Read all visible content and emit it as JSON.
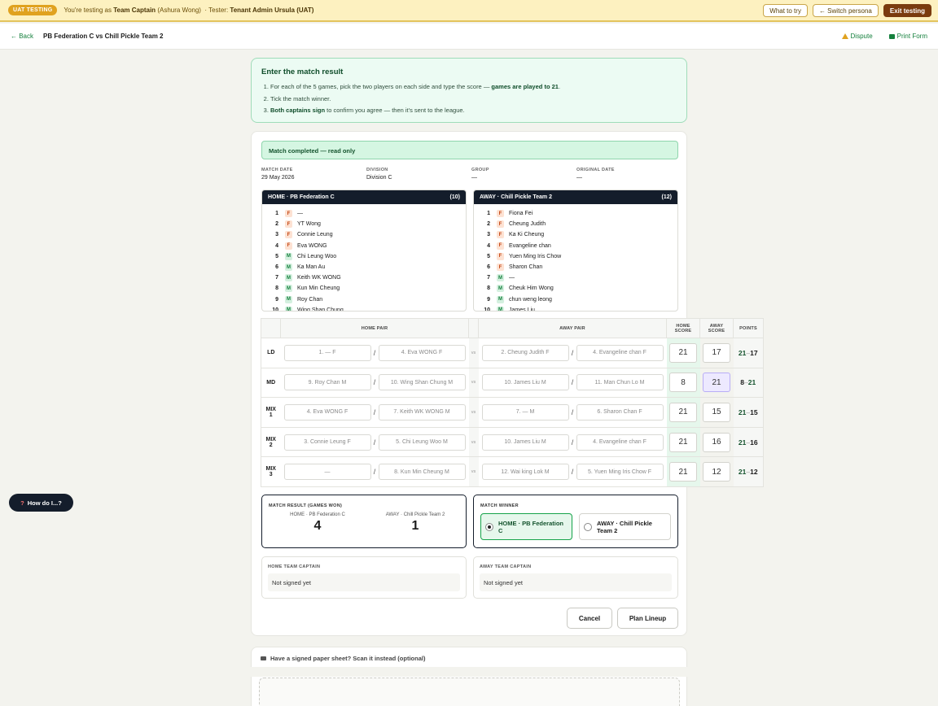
{
  "banner": {
    "pill": "UAT TESTING",
    "prefix": "You're testing as",
    "persona": "Team Captain",
    "persona_name": "(Ashura Wong)",
    "tester_label": "· Tester:",
    "tester": "Tenant Admin Ursula (UAT)",
    "what_to_try": "What to try",
    "switch_persona": "← Switch persona",
    "exit_testing": "Exit testing"
  },
  "header": {
    "back": "← Back",
    "title": "PB Federation C vs Chill Pickle Team 2",
    "dispute": "Dispute",
    "print": "Print Form"
  },
  "instructions": {
    "title": "Enter the match result",
    "step1_a": "For each of the 5 games, pick the two players on each side and type the score — ",
    "step1_b": "games are played to 21",
    "step1_c": ".",
    "step2": "Tick the match winner.",
    "step3_a": "Both captains sign",
    "step3_b": " to confirm you agree — then it's sent to the league."
  },
  "status": "Match completed — read only",
  "meta": {
    "match_date_label": "MATCH DATE",
    "match_date": "29 May 2026",
    "division_label": "DIVISION",
    "division": "Division C",
    "group_label": "GROUP",
    "group": "—",
    "orig_date_label": "ORIGINAL DATE",
    "orig_date": "—"
  },
  "home_roster": {
    "title": "HOME · PB Federation C",
    "count": "(10)",
    "players": [
      {
        "n": "1",
        "g": "F",
        "name": "—"
      },
      {
        "n": "2",
        "g": "F",
        "name": "YT Wong"
      },
      {
        "n": "3",
        "g": "F",
        "name": "Connie Leung"
      },
      {
        "n": "4",
        "g": "F",
        "name": "Eva WONG"
      },
      {
        "n": "5",
        "g": "M",
        "name": "Chi Leung Woo"
      },
      {
        "n": "6",
        "g": "M",
        "name": "Ka Man Au"
      },
      {
        "n": "7",
        "g": "M",
        "name": "Keith WK WONG"
      },
      {
        "n": "8",
        "g": "M",
        "name": "Kun Min Cheung"
      },
      {
        "n": "9",
        "g": "M",
        "name": "Roy Chan"
      },
      {
        "n": "10",
        "g": "M",
        "name": "Wing Shan Chung"
      }
    ]
  },
  "away_roster": {
    "title": "AWAY · Chill Pickle Team 2",
    "count": "(12)",
    "players": [
      {
        "n": "1",
        "g": "F",
        "name": "Fiona Fei"
      },
      {
        "n": "2",
        "g": "F",
        "name": "Cheung Judith"
      },
      {
        "n": "3",
        "g": "F",
        "name": "Ka Ki Cheung"
      },
      {
        "n": "4",
        "g": "F",
        "name": "Evangeline chan"
      },
      {
        "n": "5",
        "g": "F",
        "name": "Yuen Ming Iris Chow"
      },
      {
        "n": "6",
        "g": "F",
        "name": "Sharon Chan"
      },
      {
        "n": "7",
        "g": "M",
        "name": "—"
      },
      {
        "n": "8",
        "g": "M",
        "name": "Cheuk Him Wong"
      },
      {
        "n": "9",
        "g": "M",
        "name": "chun weng leong"
      },
      {
        "n": "10",
        "g": "M",
        "name": "James Liu"
      }
    ]
  },
  "games_header": {
    "home_pair": "HOME PAIR",
    "away_pair": "AWAY PAIR",
    "home_score_1": "HOME",
    "home_score_2": "SCORE",
    "away_score_1": "AWAY",
    "away_score_2": "SCORE",
    "points": "POINTS",
    "vs": "vs"
  },
  "games": [
    {
      "l1": "LD",
      "l2": "",
      "h1": "1. — F",
      "h2": "4. Eva WONG F",
      "a1": "2. Cheung Judith F",
      "a2": "4. Evangeline chan F",
      "hs": "21",
      "as": "17",
      "p1": "21",
      "p2": "17",
      "home_won": true
    },
    {
      "l1": "MD",
      "l2": "",
      "h1": "9. Roy Chan M",
      "h2": "10. Wing Shan Chung M",
      "a1": "10. James Liu M",
      "a2": "11. Man Chun Lo M",
      "hs": "8",
      "as": "21",
      "p1": "8",
      "p2": "21",
      "home_won": false
    },
    {
      "l1": "MIX",
      "l2": "1",
      "h1": "4. Eva WONG F",
      "h2": "7. Keith WK WONG M",
      "a1": "7. — M",
      "a2": "6. Sharon Chan F",
      "hs": "21",
      "as": "15",
      "p1": "21",
      "p2": "15",
      "home_won": true
    },
    {
      "l1": "MIX",
      "l2": "2",
      "h1": "3. Connie Leung F",
      "h2": "5. Chi Leung Woo M",
      "a1": "10. James Liu M",
      "a2": "4. Evangeline chan F",
      "hs": "21",
      "as": "16",
      "p1": "21",
      "p2": "16",
      "home_won": true
    },
    {
      "l1": "MIX",
      "l2": "3",
      "h1": "—",
      "h2": "8. Kun Min Cheung M",
      "a1": "12. Wai king Lok M",
      "a2": "5. Yuen Ming Iris Chow F",
      "hs": "21",
      "as": "12",
      "p1": "21",
      "p2": "12",
      "home_won": true
    }
  ],
  "result": {
    "label": "MATCH RESULT (GAMES WON)",
    "home_label": "HOME · PB Federation C",
    "home": "4",
    "away_label": "AWAY · Chill Pickle Team 2",
    "away": "1"
  },
  "winner": {
    "label": "MATCH WINNER",
    "home": "HOME · PB Federation C",
    "away": "AWAY · Chill Pickle Team 2",
    "selected": "home"
  },
  "signatures": {
    "home_label": "HOME TEAM CAPTAIN",
    "home_value": "Not signed yet",
    "away_label": "AWAY TEAM CAPTAIN",
    "away_value": "Not signed yet"
  },
  "buttons": {
    "cancel": "Cancel",
    "plan": "Plan Lineup"
  },
  "scan": {
    "title": "Have a signed paper sheet? Scan it instead (optional)"
  },
  "help": {
    "q": "?",
    "label": "How do I...?"
  }
}
